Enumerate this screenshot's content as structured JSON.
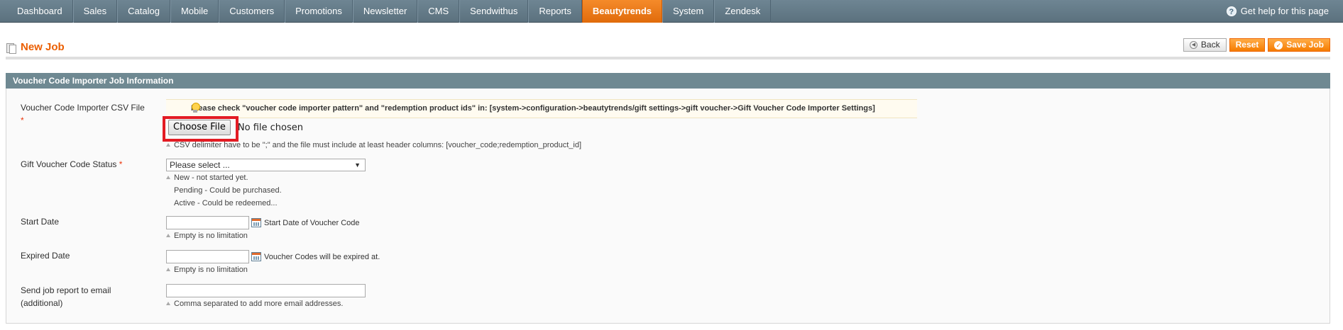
{
  "nav": {
    "items": [
      "Dashboard",
      "Sales",
      "Catalog",
      "Mobile",
      "Customers",
      "Promotions",
      "Newsletter",
      "CMS",
      "Sendwithus",
      "Reports",
      "Beautytrends",
      "System",
      "Zendesk"
    ],
    "active": "Beautytrends",
    "help": "Get help for this page"
  },
  "header": {
    "title": "New Job",
    "back": "Back",
    "reset": "Reset",
    "save": "Save Job"
  },
  "section": {
    "title": "Voucher Code Importer Job Information",
    "notice": "Please check \"voucher code importer pattern\" and \"redemption product ids\" in: [system->configuration->beautytrends/gift settings->gift voucher->Gift Voucher Code Importer Settings]"
  },
  "fields": {
    "csv": {
      "label": "Voucher Code Importer CSV File",
      "required": "*",
      "button": "Choose File",
      "status": "No file chosen",
      "note": "CSV delimiter have to be \";\" and the file must include at least header columns: [voucher_code;redemption_product_id]"
    },
    "status": {
      "label": "Gift Voucher Code Status",
      "required": "*",
      "selected": "Please select ...",
      "notes": [
        "New - not started yet.",
        "Pending - Could be purchased.",
        "Active - Could be redeemed..."
      ]
    },
    "start": {
      "label": "Start Date",
      "value": "",
      "hint": "Start Date of Voucher Code",
      "note": "Empty is no limitation"
    },
    "expired": {
      "label": "Expired Date",
      "value": "",
      "hint": "Voucher Codes will be expired at.",
      "note": "Empty is no limitation"
    },
    "email": {
      "label_line1": "Send job report to email",
      "label_line2": "(additional)",
      "value": "",
      "note": "Comma separated to add more email addresses."
    }
  },
  "colors": {
    "accent": "#eb5e00",
    "nav_bg": "#5b717e",
    "section_bg": "#6f8992",
    "highlight_box": "#e31b23"
  },
  "icons": [
    "help-icon",
    "page-icon",
    "back-icon",
    "save-icon",
    "lightbulb-icon",
    "calendar-icon",
    "dropdown-arrow-icon"
  ]
}
